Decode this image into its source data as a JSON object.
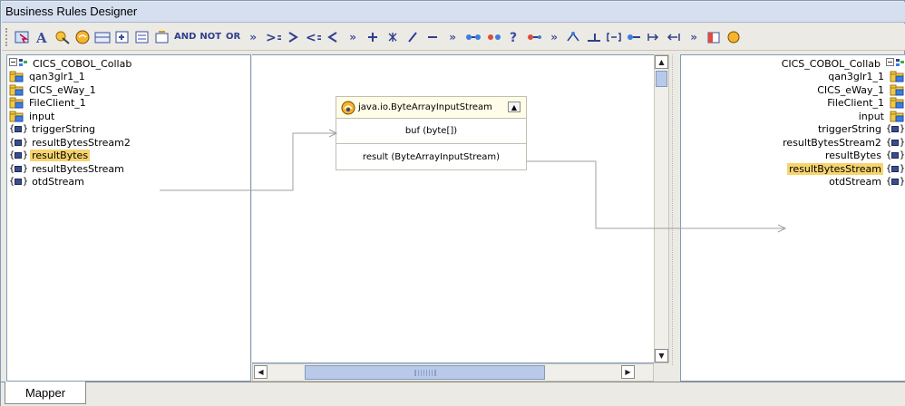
{
  "window": {
    "title": "Business Rules Designer"
  },
  "toolbar": {
    "op_and": "AND",
    "op_not": "NOT",
    "op_or": "OR",
    "more_1": "»",
    "more_2": "»",
    "more_3": "»"
  },
  "left_tree": {
    "root": "CICS_COBOL_Collab",
    "items": [
      {
        "label": "qan3glr1_1",
        "kind": "folder"
      },
      {
        "label": "CICS_eWay_1",
        "kind": "folder"
      },
      {
        "label": "FileClient_1",
        "kind": "folder"
      },
      {
        "label": "input",
        "kind": "folder"
      },
      {
        "label": "triggerString",
        "kind": "field"
      },
      {
        "label": "resultBytesStream2",
        "kind": "field"
      },
      {
        "label": "resultBytes",
        "kind": "field",
        "selected": true
      },
      {
        "label": "resultBytesStream",
        "kind": "field"
      },
      {
        "label": "otdStream",
        "kind": "field"
      }
    ]
  },
  "right_tree": {
    "root": "CICS_COBOL_Collab",
    "items": [
      {
        "label": "qan3glr1_1",
        "kind": "folder"
      },
      {
        "label": "CICS_eWay_1",
        "kind": "folder"
      },
      {
        "label": "FileClient_1",
        "kind": "folder"
      },
      {
        "label": "input",
        "kind": "folder"
      },
      {
        "label": "triggerString",
        "kind": "field"
      },
      {
        "label": "resultBytesStream2",
        "kind": "field"
      },
      {
        "label": "resultBytes",
        "kind": "field"
      },
      {
        "label": "resultBytesStream",
        "kind": "field",
        "selected": true
      },
      {
        "label": "otdStream",
        "kind": "field"
      }
    ]
  },
  "method_box": {
    "title": "java.io.ByteArrayInputStream",
    "input": "buf (byte[])",
    "output": "result (ByteArrayInputStream)"
  },
  "tabs": [
    {
      "label": "Mapper"
    }
  ],
  "colors": {
    "selection": "#f6d46e",
    "link_line": "#a0a0a0",
    "accent": "#3b4e9e"
  }
}
